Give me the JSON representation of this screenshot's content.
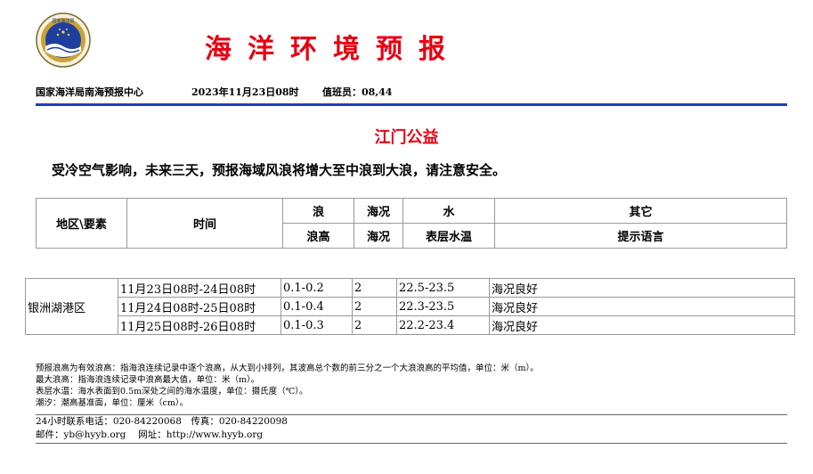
{
  "header": {
    "logo_text": "国家海洋局",
    "title": "海洋环境预报",
    "issuer": "国家海洋局南海预报中心",
    "date": "2023年11月23日08时",
    "duty": "值班员：08,44"
  },
  "colors": {
    "title_red": "#e60012",
    "rule_blue": "#1f3fbf"
  },
  "location": "江门公益",
  "headline": "受冷空气影响，未来三天，预报海域风浪将增大至中浪到大浪，请注意安全。",
  "table_header": {
    "region_col": "地区\\要素",
    "time_col": "时间",
    "wave_group": "浪",
    "wave_height": "浪高",
    "sea_group": "海况",
    "sea_state": "海况",
    "water_group": "水",
    "surface_temp": "表层水温",
    "other_group": "其它",
    "tips": "提示语言"
  },
  "table": {
    "region": "银洲湖港区",
    "rows": [
      {
        "time": "11月23日08时-24日08时",
        "wave": "0.1-0.2",
        "sea": "2",
        "temp": "22.5-23.5",
        "tip": "海况良好"
      },
      {
        "time": "11月24日08时-25日08时",
        "wave": "0.1-0.4",
        "sea": "2",
        "temp": "22.3-23.5",
        "tip": "海况良好"
      },
      {
        "time": "11月25日08时-26日08时",
        "wave": "0.1-0.3",
        "sea": "2",
        "temp": "22.2-23.4",
        "tip": "海况良好"
      }
    ]
  },
  "notes": [
    "预报浪高为有效浪高：指海浪连续记录中逐个浪高，从大到小排列，其波高总个数的前三分之一个大浪浪高的平均值，单位：米（m）。",
    "最大浪高：指海浪连续记录中浪高最大值，单位：米（m）。",
    "表层水温：海水表面到0.5m深处之间的海水温度，单位：摄氏度（℃）。",
    "潮汐：潮高基准面，单位：厘米（cm）。"
  ],
  "contact": {
    "phone": "24小时联系电话：020-84220068　传真：020-84220098",
    "email": "邮件：yb@hyyb.org　 网址：http://www.hyyb.org"
  }
}
